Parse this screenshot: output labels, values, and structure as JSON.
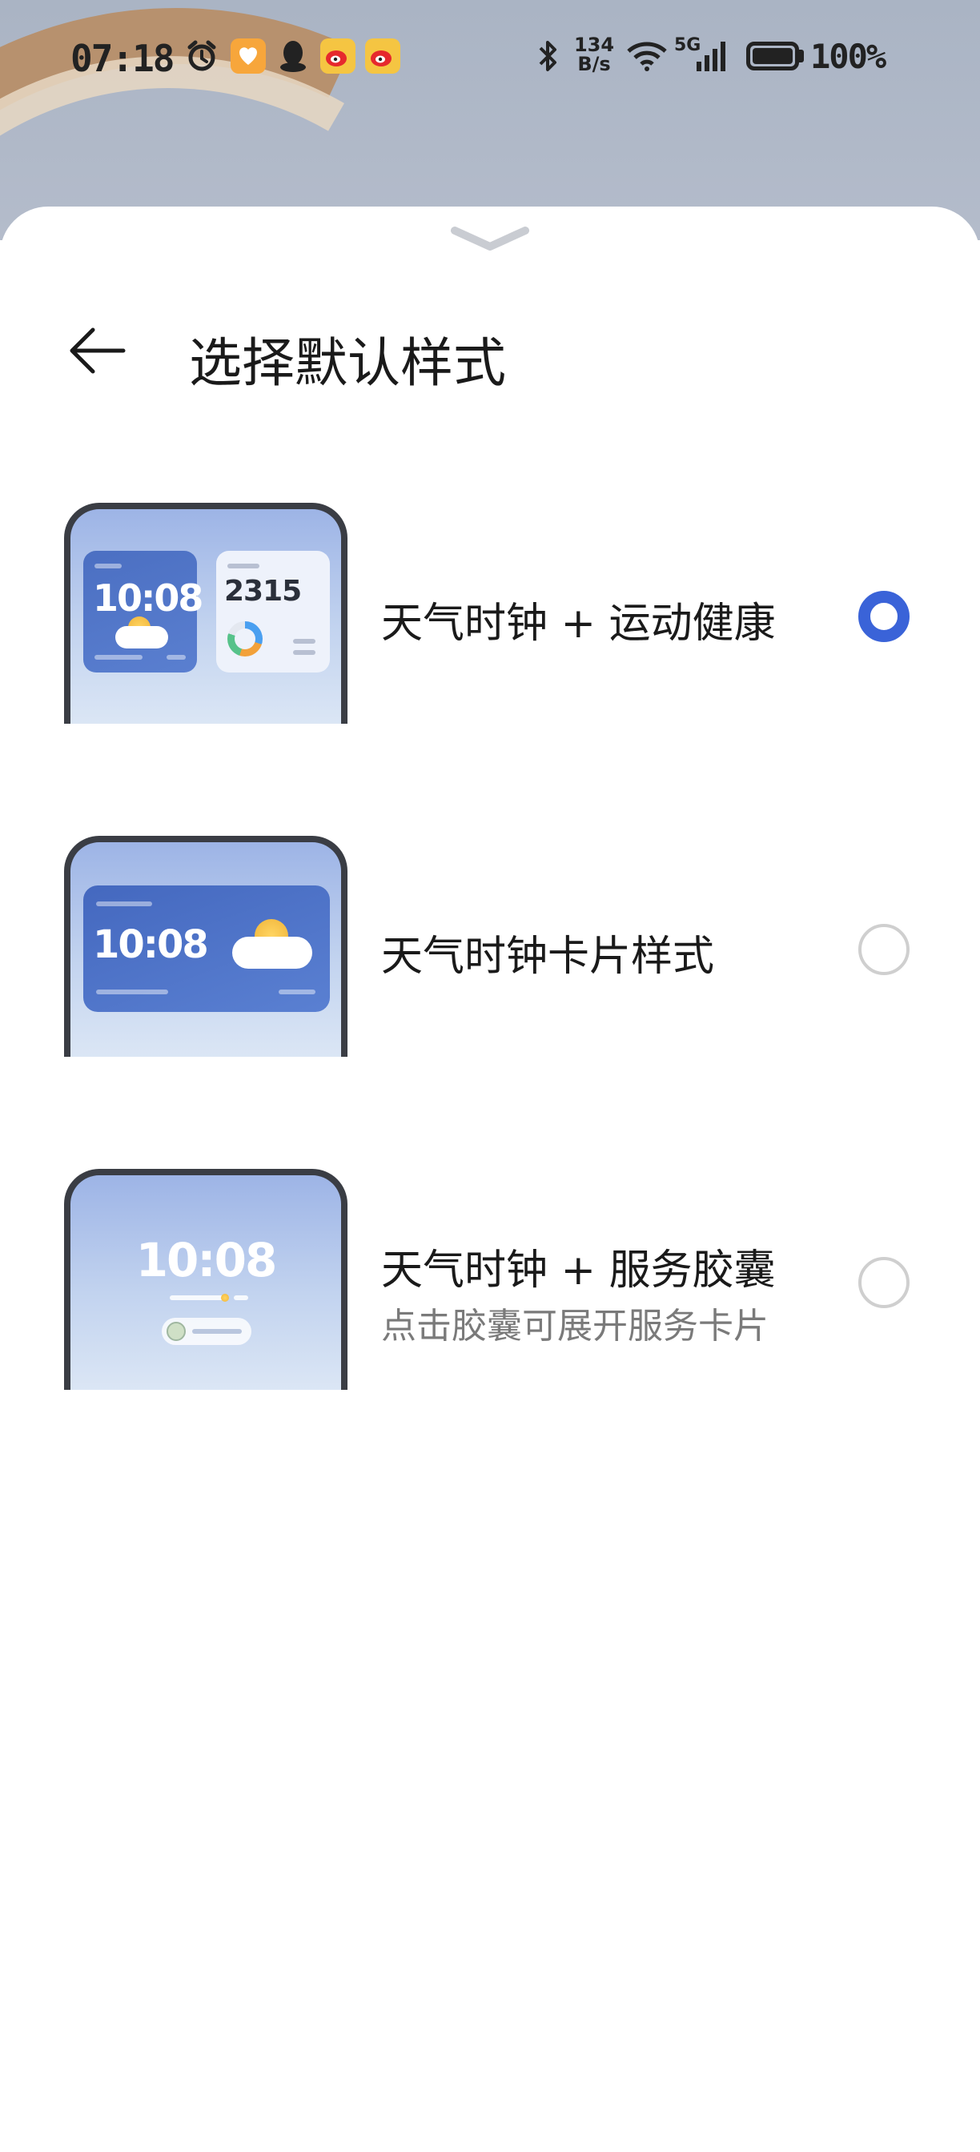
{
  "status_bar": {
    "time": "07:18",
    "net_speed_value": "134",
    "net_speed_unit": "B/s",
    "network": "5G",
    "battery": "100%",
    "icons": [
      "alarm-icon",
      "app-badge-icon",
      "qq-icon",
      "weibo-icon",
      "weibo-icon",
      "bluetooth-icon",
      "wifi-icon",
      "signal-icon",
      "battery-icon"
    ]
  },
  "header": {
    "title": "选择默认样式",
    "back_icon": "back-arrow-icon"
  },
  "options": [
    {
      "label": "天气时钟 + 运动健康",
      "subtitle": "",
      "selected": true,
      "preview": {
        "clock": "10:08",
        "steps": "2315"
      }
    },
    {
      "label": "天气时钟卡片样式",
      "subtitle": "",
      "selected": false,
      "preview": {
        "clock": "10:08"
      }
    },
    {
      "label": "天气时钟 + 服务胶囊",
      "subtitle": "点击胶囊可展开服务卡片",
      "selected": false,
      "preview": {
        "clock": "10:08"
      }
    }
  ],
  "colors": {
    "accent": "#3a63d8",
    "radio_off": "#cfcfcf",
    "text": "#1a1a1a",
    "subtext": "#7a7a7a"
  }
}
